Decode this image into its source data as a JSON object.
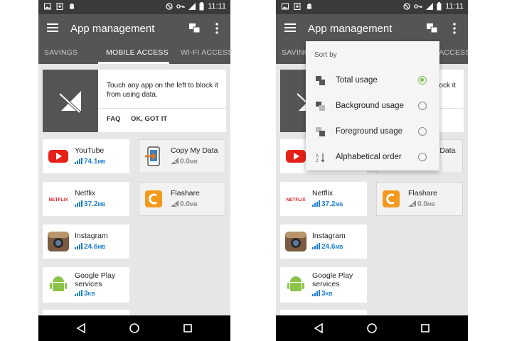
{
  "status_bar": {
    "time": "11:11",
    "icons": [
      "image-icon",
      "download-icon",
      "android-icon",
      "block-icon",
      "key-icon",
      "signal-icon",
      "battery-icon"
    ]
  },
  "app_bar": {
    "title": "App management",
    "icons": [
      "menu-icon",
      "overlap-icon",
      "more-vert-icon"
    ]
  },
  "tabs": [
    {
      "label": "SAVINGS",
      "active": false
    },
    {
      "label": "MOBILE ACCESS",
      "active": true
    },
    {
      "label": "WI-FI ACCESS",
      "active": false
    }
  ],
  "banner": {
    "message": "Touch any app on the left to block it from using data.",
    "faq_label": "FAQ",
    "ok_label": "OK, GOT IT"
  },
  "apps_left": [
    {
      "name": "YouTube",
      "usage": "74.1",
      "unit": "MB"
    },
    {
      "name": "Netflix",
      "usage": "37.2",
      "unit": "MB"
    },
    {
      "name": "Instagram",
      "usage": "24.6",
      "unit": "MB"
    },
    {
      "name": "Google Play services",
      "usage": "3",
      "unit": "KB"
    }
  ],
  "apps_right": [
    {
      "name": "Copy My Data",
      "usage": "0.0",
      "unit": "MB"
    },
    {
      "name": "Flashare",
      "usage": "0.0",
      "unit": "MB"
    }
  ],
  "sort_menu": {
    "title": "Sort by",
    "options": [
      {
        "label": "Total usage",
        "selected": true
      },
      {
        "label": "Background usage",
        "selected": false
      },
      {
        "label": "Foreground usage",
        "selected": false
      },
      {
        "label": "Alphabetical order",
        "selected": false
      }
    ]
  },
  "colors": {
    "app_bar": "#555555",
    "status_bar": "#3a3a3a",
    "usage_blue": "#1e7fd3",
    "radio_selected": "#7cc04a"
  }
}
